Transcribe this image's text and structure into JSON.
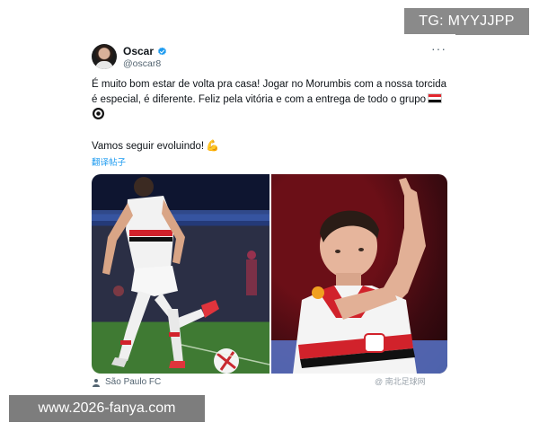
{
  "overlay": {
    "tg_label": "TG: MYYJJPP",
    "domain_label": "www.2026-fanya.com"
  },
  "tweet": {
    "display_name": "Oscar",
    "handle": "@oscar8",
    "paragraph_1": "É muito bom estar de volta pra casa! Jogar no Morumbis com a nossa torcida é especial, é diferente. Feliz pela vitória e com a entrega de todo o grupo",
    "paragraph_2": "Vamos seguir evoluindo!",
    "translate_label": "翻译帖子",
    "more_label": "···",
    "verified_color": "#1d9bf0",
    "image_source": "São Paulo FC",
    "watermark": "@ 南北足球网"
  },
  "icons": {
    "verified": "verified-badge-icon",
    "more": "more-options-icon",
    "flag": "flag-emoji-icon",
    "ball": "soccer-ball-emoji-icon",
    "muscle": "flexed-biceps-emoji-icon",
    "user": "user-icon"
  }
}
